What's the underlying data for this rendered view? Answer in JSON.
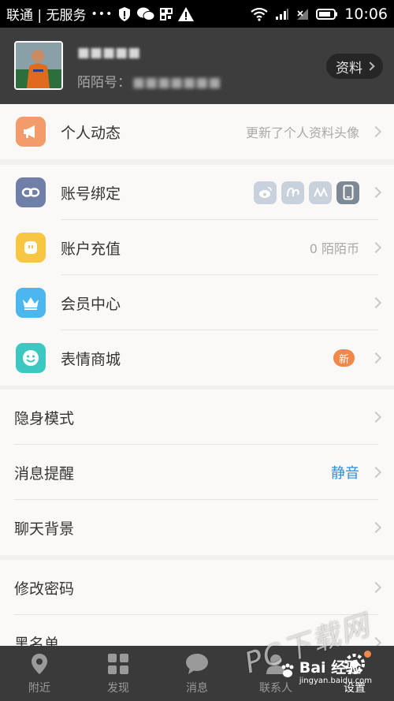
{
  "status_bar": {
    "carrier": "联通 | 无服务",
    "time": "10:06"
  },
  "profile": {
    "nickname": "■■■■■",
    "momo_id_label": "陌陌号：",
    "momo_id_value": "■■■■■■■",
    "profile_button": "资料"
  },
  "section1": {
    "items": [
      {
        "label": "个人动态",
        "value": "更新了个人资料头像",
        "icon": "megaphone-icon",
        "color": "#f39c6b"
      }
    ]
  },
  "section2": {
    "items": [
      {
        "label": "账号绑定",
        "icon": "link-icon",
        "color": "#6f7fa8"
      },
      {
        "label": "账户充值",
        "value": "0 陌陌币",
        "icon": "coin-icon",
        "color": "#f7c744"
      },
      {
        "label": "会员中心",
        "icon": "crown-icon",
        "color": "#4cb7ef"
      },
      {
        "label": "表情商城",
        "badge": "新",
        "icon": "smiley-icon",
        "color": "#3cc8c0"
      }
    ],
    "bind_icons": [
      "weibo-icon",
      "renren-icon",
      "douban-icon",
      "phone-icon"
    ]
  },
  "section3": {
    "items": [
      {
        "label": "隐身模式"
      },
      {
        "label": "消息提醒",
        "value": "静音",
        "value_color": "#2d8fd6"
      },
      {
        "label": "聊天背景"
      }
    ]
  },
  "section4": {
    "items": [
      {
        "label": "修改密码"
      },
      {
        "label": "黑名单"
      }
    ]
  },
  "tabbar": {
    "tabs": [
      {
        "label": "附近",
        "icon": "location-pin-icon"
      },
      {
        "label": "发现",
        "icon": "grid-icon"
      },
      {
        "label": "消息",
        "icon": "chat-bubble-icon"
      },
      {
        "label": "联系人",
        "icon": "contacts-icon"
      },
      {
        "label": "设置",
        "icon": "settings-icon"
      }
    ]
  },
  "watermark": {
    "pc": "PC下载网",
    "baidu": "Bai 经验",
    "baidu_sub": "jingyan.baidu.com"
  }
}
